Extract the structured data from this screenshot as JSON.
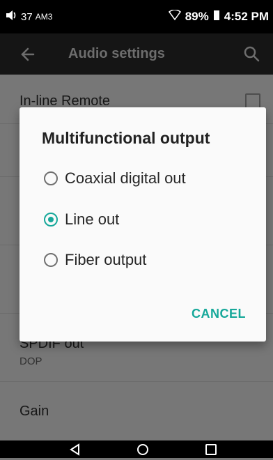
{
  "status_bar": {
    "volume_level": "37",
    "network": "AM3",
    "battery": "89%",
    "time": "4:52 PM"
  },
  "toolbar": {
    "title": "Audio settings"
  },
  "settings_list": [
    {
      "title": "In-line Remote",
      "subtitle": "",
      "checked": false
    },
    {
      "title": "SPDIF out",
      "subtitle": "DOP"
    },
    {
      "title": "Gain",
      "subtitle": ""
    }
  ],
  "dialog": {
    "title": "Multifunctional output",
    "options": [
      {
        "label": "Coaxial digital out",
        "selected": false
      },
      {
        "label": "Line out",
        "selected": true
      },
      {
        "label": "Fiber output",
        "selected": false
      }
    ],
    "cancel_label": "CANCEL"
  },
  "colors": {
    "accent": "#16a89a",
    "status_bar": "#000000",
    "toolbar": "#151515"
  },
  "icons": {
    "back": "arrow-left",
    "search": "magnifier",
    "nav_back": "triangle-left",
    "nav_home": "circle",
    "nav_recents": "square"
  }
}
